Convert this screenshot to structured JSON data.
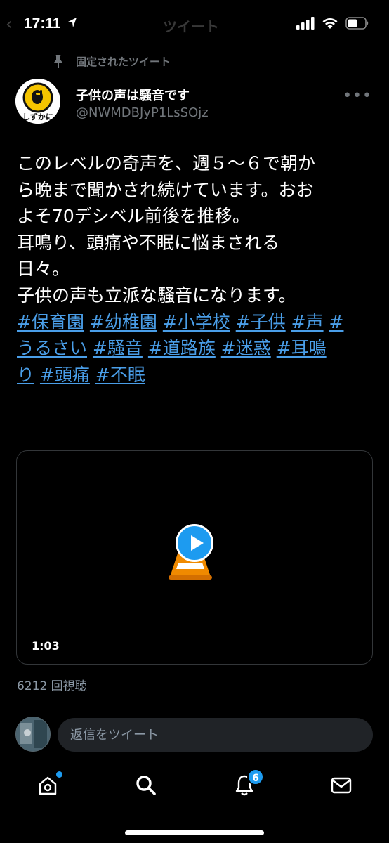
{
  "status_bar": {
    "time": "17:11",
    "screen_title": "ツイート"
  },
  "tweet": {
    "pinned_label": "固定されたツイート",
    "author": {
      "display_name": "子供の声は騒音です",
      "handle": "@NWMDBJyP1LsSOjz",
      "avatar_text": "しずかに"
    },
    "text_lines": [
      "このレベルの奇声を、週５〜６で朝か",
      "ら晩まで聞かされ続けています。おお",
      "よそ70デシベル前後を推移。",
      "耳鳴り、頭痛や不眠に悩まされる",
      "日々。",
      "子供の声も立派な騒音になります。"
    ],
    "hashtags": {
      "line1": [
        "#保育園",
        "#幼稚園",
        "#小学校",
        "#子供",
        "#声",
        "#"
      ],
      "line2": [
        "うるさい",
        "#騒音",
        "#道路族",
        "#迷惑",
        "#耳鳴"
      ],
      "line3": [
        "り",
        "#頭痛",
        "#不眠"
      ]
    },
    "video": {
      "duration": "1:03"
    },
    "view_count": "6212 回視聴"
  },
  "reply": {
    "placeholder": "返信をツイート"
  },
  "tab_bar": {
    "notifications_badge": "6",
    "items": [
      "home-icon",
      "search-icon",
      "notifications-icon",
      "messages-icon"
    ]
  },
  "colors": {
    "accent": "#1d9bf0",
    "hashtag": "#4a9ee8",
    "secondary_text": "#71767b",
    "background": "#000000"
  }
}
